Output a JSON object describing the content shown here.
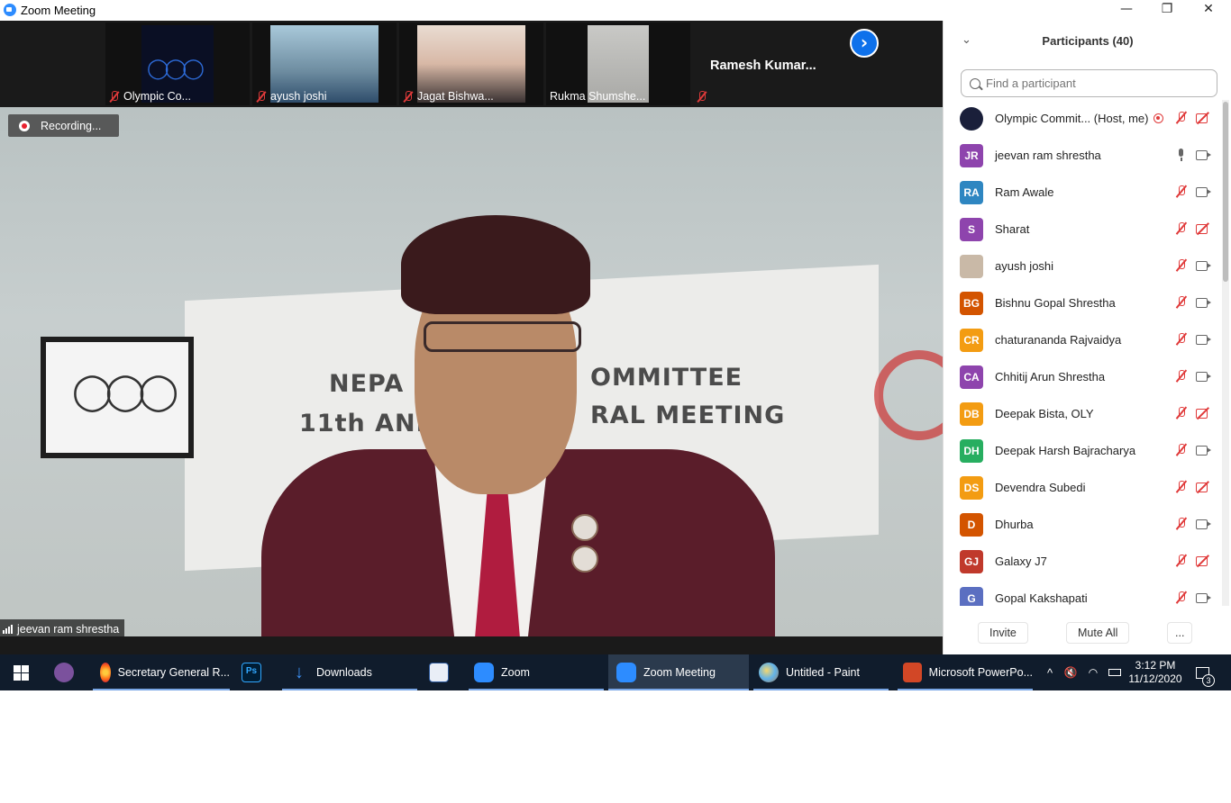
{
  "window": {
    "title": "Zoom Meeting",
    "controls": {
      "minimize": "—",
      "restore": "❐",
      "close": "✕"
    }
  },
  "thumbnails": [
    {
      "name": "Olympic Co...",
      "muted": true
    },
    {
      "name": "ayush joshi",
      "muted": true
    },
    {
      "name": "Jagat Bishwa...",
      "muted": true
    },
    {
      "name": "Rukma Shumshe...",
      "muted": false
    },
    {
      "name": "Ramesh  Kumar...",
      "muted": true
    }
  ],
  "next_page_glyph": "›",
  "stage": {
    "recording_label": "Recording...",
    "speaker_name": "jeevan ram shrestha",
    "sign_line1_left": "NEPA",
    "sign_line1_right": "OMMITTEE",
    "sign_line2_left": "11th ANN",
    "sign_line2_right": "RAL MEETING"
  },
  "panel": {
    "title": "Participants (40)",
    "collapse_glyph": "⌄",
    "search_placeholder": "Find a participant",
    "participants": [
      {
        "initials": "",
        "name": "Olympic Commit...  (Host, me)",
        "color": "#1a1f3a",
        "mic": "muted",
        "cam": "off",
        "recording": true
      },
      {
        "initials": "JR",
        "name": "jeevan ram shrestha",
        "color": "#8e44ad",
        "mic": "on",
        "cam": "on",
        "recording": false
      },
      {
        "initials": "RA",
        "name": "Ram Awale",
        "color": "#2e86c1",
        "mic": "muted",
        "cam": "on",
        "recording": false
      },
      {
        "initials": "S",
        "name": "Sharat",
        "color": "#8e44ad",
        "mic": "muted",
        "cam": "off",
        "recording": false
      },
      {
        "initials": "",
        "name": "ayush joshi",
        "color": "#c9b9a7",
        "mic": "muted",
        "cam": "on",
        "recording": false
      },
      {
        "initials": "BG",
        "name": "Bishnu Gopal Shrestha",
        "color": "#d35400",
        "mic": "muted",
        "cam": "on",
        "recording": false
      },
      {
        "initials": "CR",
        "name": "chaturananda Rajvaidya",
        "color": "#f39c12",
        "mic": "muted",
        "cam": "on",
        "recording": false
      },
      {
        "initials": "CA",
        "name": "Chhitij Arun Shrestha",
        "color": "#8e44ad",
        "mic": "muted",
        "cam": "on",
        "recording": false
      },
      {
        "initials": "DB",
        "name": "Deepak Bista, OLY",
        "color": "#f39c12",
        "mic": "muted",
        "cam": "off",
        "recording": false
      },
      {
        "initials": "DH",
        "name": "Deepak Harsh Bajracharya",
        "color": "#27ae60",
        "mic": "muted",
        "cam": "on",
        "recording": false
      },
      {
        "initials": "DS",
        "name": "Devendra Subedi",
        "color": "#f39c12",
        "mic": "muted",
        "cam": "off",
        "recording": false
      },
      {
        "initials": "D",
        "name": "Dhurba",
        "color": "#d35400",
        "mic": "muted",
        "cam": "on",
        "recording": false
      },
      {
        "initials": "GJ",
        "name": "Galaxy J7",
        "color": "#c0392b",
        "mic": "muted",
        "cam": "off",
        "recording": false
      },
      {
        "initials": "G",
        "name": "Gopal Kakshapati",
        "color": "#5b6fc1",
        "mic": "muted",
        "cam": "on",
        "recording": false
      }
    ],
    "footer": {
      "invite": "Invite",
      "mute_all": "Mute All",
      "more": "..."
    }
  },
  "taskbar": {
    "items": [
      {
        "label": "",
        "icon": "viber-icon"
      },
      {
        "label": "Secretary General R...",
        "icon": "firefox-icon"
      },
      {
        "label": "",
        "icon": "photoshop-icon"
      },
      {
        "label": "Downloads",
        "icon": "downloads-folder-icon"
      },
      {
        "label": "",
        "icon": "word-icon"
      },
      {
        "label": "Zoom",
        "icon": "zoom-icon"
      },
      {
        "label": "Zoom Meeting",
        "icon": "zoom-icon"
      },
      {
        "label": "Untitled - Paint",
        "icon": "paint-icon"
      },
      {
        "label": "Microsoft PowerPo...",
        "icon": "powerpoint-icon"
      }
    ],
    "time": "3:12 PM",
    "date": "11/12/2020",
    "notification_count": "3",
    "tray_chevron": "^"
  }
}
